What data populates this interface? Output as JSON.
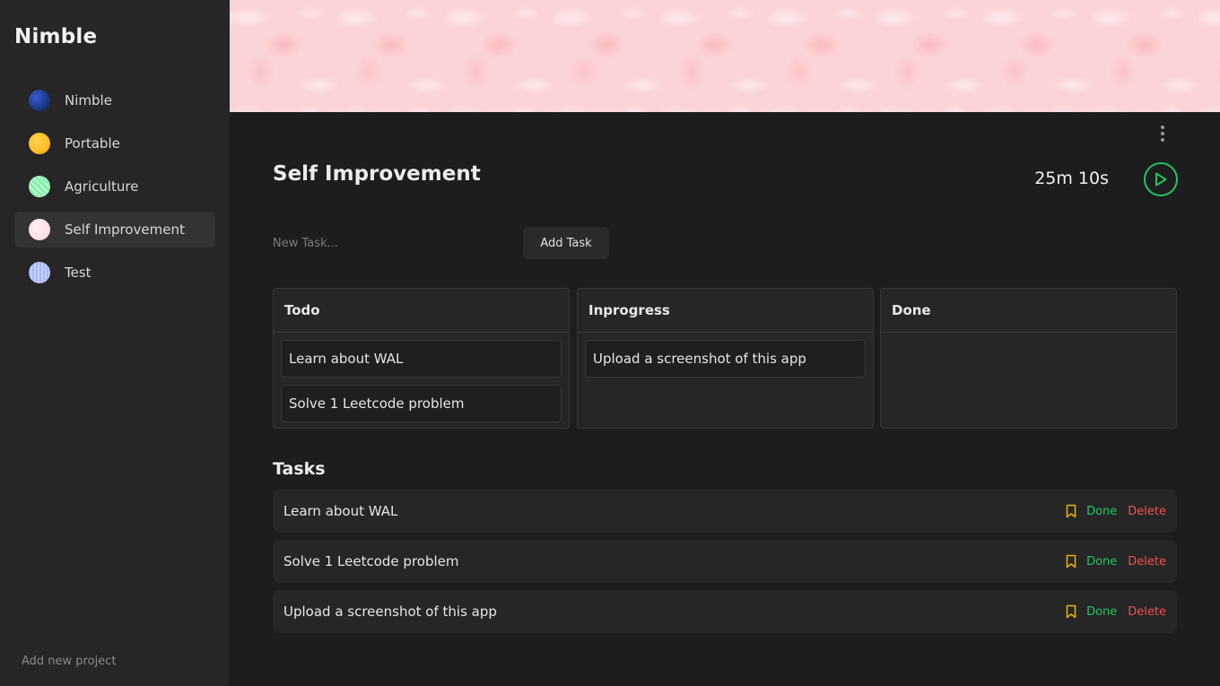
{
  "app": {
    "title": "Nimble"
  },
  "sidebar": {
    "projects": [
      {
        "label": "Nimble",
        "dot_color": "#1e3a8a",
        "active": false
      },
      {
        "label": "Portable",
        "dot_color": "#fbbf24",
        "active": false
      },
      {
        "label": "Agriculture",
        "dot_color": "#86efac",
        "active": false
      },
      {
        "label": "Self Improvement",
        "dot_color": "#fde2e7",
        "active": true
      },
      {
        "label": "Test",
        "dot_color": "#a5b4fc",
        "active": false
      }
    ],
    "add_project_label": "Add new project"
  },
  "banner": {
    "color": "#fcd3d6"
  },
  "project": {
    "title": "Self Improvement",
    "timer": "25m 10s"
  },
  "new_task": {
    "placeholder": "New Task...",
    "value": "",
    "button_label": "Add Task"
  },
  "board": {
    "columns": [
      {
        "title": "Todo",
        "cards": [
          "Learn about WAL",
          "Solve 1 Leetcode problem"
        ]
      },
      {
        "title": "Inprogress",
        "cards": [
          "Upload a screenshot of this app"
        ]
      },
      {
        "title": "Done",
        "cards": []
      }
    ]
  },
  "tasks": {
    "title": "Tasks",
    "items": [
      {
        "text": "Learn about WAL",
        "done_label": "Done",
        "delete_label": "Delete"
      },
      {
        "text": "Solve 1 Leetcode problem",
        "done_label": "Done",
        "delete_label": "Delete"
      },
      {
        "text": "Upload a screenshot of this app",
        "done_label": "Done",
        "delete_label": "Delete"
      }
    ]
  },
  "colors": {
    "accent_green": "#22c55e",
    "delete_red": "#f05252",
    "bookmark_yellow": "#eab308"
  },
  "icons": {
    "menu": "kebab-menu-icon",
    "play": "play-icon",
    "bookmark": "bookmark-icon"
  }
}
